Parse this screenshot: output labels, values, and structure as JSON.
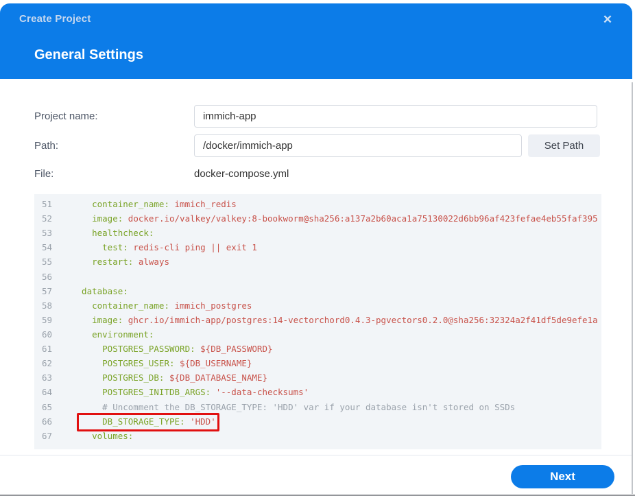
{
  "dialog": {
    "title": "Create Project",
    "close_icon": "✕",
    "section_title": "General Settings"
  },
  "form": {
    "project_name_label": "Project name:",
    "project_name_value": "immich-app",
    "path_label": "Path:",
    "path_value": "/docker/immich-app",
    "set_path_button": "Set Path",
    "file_label": "File:",
    "file_value": "docker-compose.yml"
  },
  "editor": {
    "file_type": "yaml",
    "highlight_line": 66,
    "lines": [
      {
        "no": "51",
        "tokens": [
          [
            "k",
            "    container_name:"
          ],
          [
            "v",
            " immich_redis"
          ]
        ]
      },
      {
        "no": "52",
        "tokens": [
          [
            "k",
            "    image:"
          ],
          [
            "v",
            " docker.io/valkey/valkey:8-bookworm@sha256:a137a2b60aca1a75130022d6bb96af423fefae4eb55faf395"
          ]
        ]
      },
      {
        "no": "53",
        "tokens": [
          [
            "k",
            "    healthcheck:"
          ]
        ]
      },
      {
        "no": "54",
        "tokens": [
          [
            "k",
            "      test:"
          ],
          [
            "v",
            " redis-cli ping || exit 1"
          ]
        ]
      },
      {
        "no": "55",
        "tokens": [
          [
            "k",
            "    restart:"
          ],
          [
            "v",
            " always"
          ]
        ]
      },
      {
        "no": "56",
        "tokens": []
      },
      {
        "no": "57",
        "tokens": [
          [
            "k",
            "  database:"
          ]
        ]
      },
      {
        "no": "58",
        "tokens": [
          [
            "k",
            "    container_name:"
          ],
          [
            "v",
            " immich_postgres"
          ]
        ]
      },
      {
        "no": "59",
        "tokens": [
          [
            "k",
            "    image:"
          ],
          [
            "v",
            " ghcr.io/immich-app/postgres:14-vectorchord0.4.3-pgvectors0.2.0@sha256:32324a2f41df5de9efe1a"
          ]
        ]
      },
      {
        "no": "60",
        "tokens": [
          [
            "k",
            "    environment:"
          ]
        ]
      },
      {
        "no": "61",
        "tokens": [
          [
            "k",
            "      POSTGRES_PASSWORD:"
          ],
          [
            "v",
            " ${DB_PASSWORD}"
          ]
        ]
      },
      {
        "no": "62",
        "tokens": [
          [
            "k",
            "      POSTGRES_USER:"
          ],
          [
            "v",
            " ${DB_USERNAME}"
          ]
        ]
      },
      {
        "no": "63",
        "tokens": [
          [
            "k",
            "      POSTGRES_DB:"
          ],
          [
            "v",
            " ${DB_DATABASE_NAME}"
          ]
        ]
      },
      {
        "no": "64",
        "tokens": [
          [
            "k",
            "      POSTGRES_INITDB_ARGS:"
          ],
          [
            "v",
            " '--data-checksums'"
          ]
        ]
      },
      {
        "no": "65",
        "tokens": [
          [
            "c",
            "      # Uncomment the DB_STORAGE_TYPE: 'HDD' var if your database isn't stored on SSDs"
          ]
        ]
      },
      {
        "no": "66",
        "tokens": [
          [
            "k",
            "      DB_STORAGE_TYPE:"
          ],
          [
            "v",
            " 'HDD'"
          ]
        ]
      },
      {
        "no": "67",
        "tokens": [
          [
            "k",
            "    volumes:"
          ]
        ]
      }
    ]
  },
  "footer": {
    "next_button": "Next"
  },
  "colors": {
    "accent": "#0c7ce8",
    "yaml_key": "#7aa327",
    "yaml_value": "#c8524a",
    "yaml_comment": "#9aa2ab",
    "highlight_box": "#e11010"
  }
}
